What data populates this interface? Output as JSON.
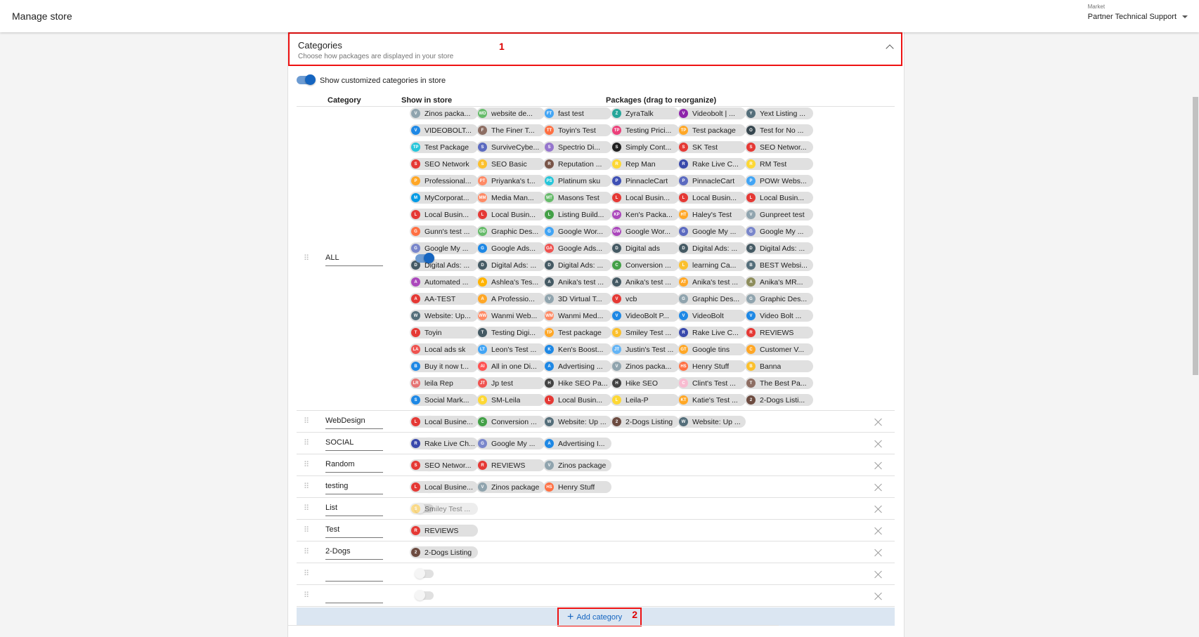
{
  "header": {
    "title": "Manage store",
    "market_label": "Market",
    "market_value": "Partner Technical Support"
  },
  "categories_panel": {
    "title": "Categories",
    "subtitle": "Choose how packages are displayed in your store",
    "annotation": "1",
    "show_customized_label": "Show customized categories in store",
    "show_customized_on": true
  },
  "columns": {
    "category": "Category",
    "show": "Show in store",
    "packages": "Packages (drag to reorganize)"
  },
  "all_packages": [
    [
      "Zinos packa...",
      "website de...",
      "fast test",
      "ZyraTalk",
      "Videobolt | ...",
      "Yext Listing ..."
    ],
    [
      "VIDEOBOLT...",
      "The Finer T...",
      "Toyin's Test",
      "Testing Prici...",
      "Test package",
      "Test for No ..."
    ],
    [
      "Test Package",
      "SurviveCybe...",
      "Spectrio Di...",
      "Simply Cont...",
      "SK Test",
      "SEO Networ..."
    ],
    [
      "SEO Network",
      "SEO Basic",
      "Reputation ...",
      "Rep Man",
      "Rake Live C...",
      "RM Test"
    ],
    [
      "Professional...",
      "Priyanka's t...",
      "Platinum sku",
      "PinnacleCart",
      "PinnacleCart",
      "POWr Webs..."
    ],
    [
      "MyCorporat...",
      "Media Man...",
      "Masons Test",
      "Local Busin...",
      "Local Busin...",
      "Local Busin..."
    ],
    [
      "Local Busin...",
      "Local Busin...",
      "Listing Build...",
      "Ken's Packa...",
      "Haley's Test",
      "Gunpreet test"
    ],
    [
      "Gunn's test ...",
      "Graphic Des...",
      "Google Wor...",
      "Google Wor...",
      "Google My ...",
      "Google My ..."
    ],
    [
      "Google My ...",
      "Google Ads...",
      "Google Ads...",
      "Digital ads",
      "Digital Ads: ...",
      "Digital Ads: ..."
    ],
    [
      "Digital Ads: ...",
      "Digital Ads: ...",
      "Digital Ads: ...",
      "Conversion ...",
      "learning Ca...",
      "BEST Websi..."
    ],
    [
      "Automated ...",
      "Ashlea's Tes...",
      "Anika's test ...",
      "Anika's test ...",
      "Anika's test ...",
      "Anika's MR..."
    ],
    [
      "AA-TEST",
      "A Professio...",
      "3D Virtual T...",
      "vcb",
      "Graphic Des...",
      "Graphic Des..."
    ],
    [
      "Website: Up...",
      "Wanmi Web...",
      "Wanmi Med...",
      "VideoBolt P...",
      "VideoBolt",
      "Video Bolt ..."
    ],
    [
      "Toyin",
      "Testing Digi...",
      "Test package",
      "Smiley Test ...",
      "Rake Live C...",
      "REVIEWS"
    ],
    [
      "Local ads sk",
      "Leon's Test ...",
      "Ken's Boost...",
      "Justin's Test ...",
      "Google tins",
      "Customer V..."
    ],
    [
      "Buy it now t...",
      "All in one Di...",
      "Advertising ...",
      "Zinos packa...",
      "Henry Stuff",
      "Banna"
    ],
    [
      "leila Rep",
      "Jp test",
      "Hike SEO Pa...",
      "Hike SEO",
      "Clint's Test ...",
      "The Best Pa..."
    ],
    [
      "Social Mark...",
      "SM-Leila",
      "Local Busin...",
      "Leila-P",
      "Katie's Test ...",
      "2-Dogs Listi..."
    ]
  ],
  "all_avatars": [
    [
      "V",
      "WD",
      "FT",
      "Z",
      "V",
      "Y"
    ],
    [
      "V",
      "F",
      "TT",
      "TP",
      "TP",
      "O"
    ],
    [
      "TP",
      "S",
      "S",
      "S",
      "S",
      "S"
    ],
    [
      "S",
      "S",
      "R",
      "R",
      "R",
      "R"
    ],
    [
      "P",
      "PT",
      "PS",
      "P",
      "P",
      "P"
    ],
    [
      "M",
      "MM",
      "MT",
      "L",
      "L",
      "L"
    ],
    [
      "L",
      "L",
      "L",
      "KP",
      "HT",
      "V"
    ],
    [
      "G",
      "GD",
      "G",
      "GW",
      "G",
      "G"
    ],
    [
      "G",
      "G",
      "GA",
      "D",
      "D",
      "D"
    ],
    [
      "D",
      "D",
      "D",
      "C",
      "L",
      "B"
    ],
    [
      "A",
      "A",
      "A",
      "A",
      "AT",
      "A"
    ],
    [
      "A",
      "A",
      "V",
      "V",
      "G",
      "G"
    ],
    [
      "W",
      "WW",
      "WM",
      "V",
      "V",
      "V"
    ],
    [
      "T",
      "T",
      "TP",
      "S",
      "R",
      "R"
    ],
    [
      "LA",
      "LT",
      "K",
      "JT",
      "GT",
      "C"
    ],
    [
      "B",
      "AI",
      "A",
      "V",
      "HS",
      "B"
    ],
    [
      "LR",
      "JT",
      "H",
      "H",
      "C",
      "T"
    ],
    [
      "S",
      "S",
      "L",
      "L",
      "KT",
      "2"
    ]
  ],
  "all_colors": [
    [
      "#90a4ae",
      "#66bb6a",
      "#42a5f5",
      "#26a69a",
      "#8e24aa",
      "#546e7a"
    ],
    [
      "#1e88e5",
      "#8d6e63",
      "#ff7043",
      "#ec407a",
      "#ffa726",
      "#37474f"
    ],
    [
      "#26c6da",
      "#5c6bc0",
      "#9575cd",
      "#212121",
      "#e53935",
      "#e53935"
    ],
    [
      "#e53935",
      "#fbc02d",
      "#795548",
      "#fdd835",
      "#3949ab",
      "#fdd835"
    ],
    [
      "#ffa726",
      "#ff8a65",
      "#26c6da",
      "#3f51b5",
      "#5c6bc0",
      "#42a5f5"
    ],
    [
      "#039be5",
      "#ff8a65",
      "#66bb6a",
      "#e53935",
      "#e53935",
      "#e53935"
    ],
    [
      "#e53935",
      "#e53935",
      "#43a047",
      "#ab47bc",
      "#ffa726",
      "#90a4ae"
    ],
    [
      "#ff7043",
      "#66bb6a",
      "#42a5f5",
      "#ab47bc",
      "#5c6bc0",
      "#7986cb"
    ],
    [
      "#7986cb",
      "#1e88e5",
      "#ef5350",
      "#455a64",
      "#455a64",
      "#455a64"
    ],
    [
      "#455a64",
      "#455a64",
      "#455a64",
      "#43a047",
      "#fbc02d",
      "#546e7a"
    ],
    [
      "#ab47bc",
      "#ffb300",
      "#455a64",
      "#455a64",
      "#ffa726",
      "#8d8d5c"
    ],
    [
      "#e53935",
      "#ffa726",
      "#90a4ae",
      "#e53935",
      "#90a4ae",
      "#90a4ae"
    ],
    [
      "#546e7a",
      "#ff8a65",
      "#ff8a65",
      "#1e88e5",
      "#1e88e5",
      "#1e88e5"
    ],
    [
      "#e53935",
      "#455a64",
      "#ffa726",
      "#fbc02d",
      "#3949ab",
      "#e53935"
    ],
    [
      "#ef5350",
      "#42a5f5",
      "#1e88e5",
      "#64b5f6",
      "#ffa726",
      "#ffa726"
    ],
    [
      "#1e88e5",
      "#ff5252",
      "#1e88e5",
      "#90a4ae",
      "#ff7043",
      "#fbc02d"
    ],
    [
      "#e57373",
      "#ef5350",
      "#424242",
      "#424242",
      "#f8bbd0",
      "#8d6e63"
    ],
    [
      "#1e88e5",
      "#fdd835",
      "#e53935",
      "#fdd835",
      "#ffa726",
      "#6d4c41"
    ]
  ],
  "rows": [
    {
      "name": "ALL",
      "show": "on"
    },
    {
      "name": "WebDesign",
      "show": "on",
      "packages": [
        {
          "label": "Local Busine...",
          "av": "L",
          "color": "#e53935"
        },
        {
          "label": "Conversion ...",
          "av": "C",
          "color": "#43a047"
        },
        {
          "label": "Website: Up ...",
          "av": "W",
          "color": "#546e7a"
        },
        {
          "label": "2-Dogs Listing",
          "av": "2",
          "color": "#6d4c41"
        },
        {
          "label": "Website: Up ...",
          "av": "W",
          "color": "#546e7a"
        }
      ]
    },
    {
      "name": "SOCIAL",
      "show": "on",
      "packages": [
        {
          "label": "Rake Live Ch...",
          "av": "R",
          "color": "#3949ab"
        },
        {
          "label": "Google My ...",
          "av": "G",
          "color": "#7986cb"
        },
        {
          "label": "Advertising I...",
          "av": "A",
          "color": "#1e88e5"
        }
      ]
    },
    {
      "name": "Random",
      "show": "on",
      "packages": [
        {
          "label": "SEO Networ...",
          "av": "S",
          "color": "#e53935"
        },
        {
          "label": "REVIEWS",
          "av": "R",
          "color": "#e53935"
        },
        {
          "label": "Zinos package",
          "av": "V",
          "color": "#90a4ae"
        }
      ]
    },
    {
      "name": "testing",
      "show": "on",
      "packages": [
        {
          "label": "Local Busine...",
          "av": "L",
          "color": "#e53935"
        },
        {
          "label": "Zinos package",
          "av": "V",
          "color": "#90a4ae"
        },
        {
          "label": "Henry Stuff",
          "av": "HS",
          "color": "#ff7043"
        }
      ]
    },
    {
      "name": "List",
      "show": "off",
      "packages": [
        {
          "label": "Smiley Test ...",
          "av": "S",
          "color": "#fbc02d",
          "dim": true
        }
      ]
    },
    {
      "name": "Test",
      "show": "on",
      "packages": [
        {
          "label": "REVIEWS",
          "av": "R",
          "color": "#e53935"
        }
      ]
    },
    {
      "name": "2-Dogs",
      "show": "on",
      "packages": [
        {
          "label": "2-Dogs Listing",
          "av": "2",
          "color": "#6d4c41"
        }
      ]
    },
    {
      "name": "",
      "show": "disabled",
      "packages": []
    },
    {
      "name": "",
      "show": "disabled",
      "packages": []
    }
  ],
  "add_category": {
    "label": "Add category",
    "annotation": "2"
  }
}
